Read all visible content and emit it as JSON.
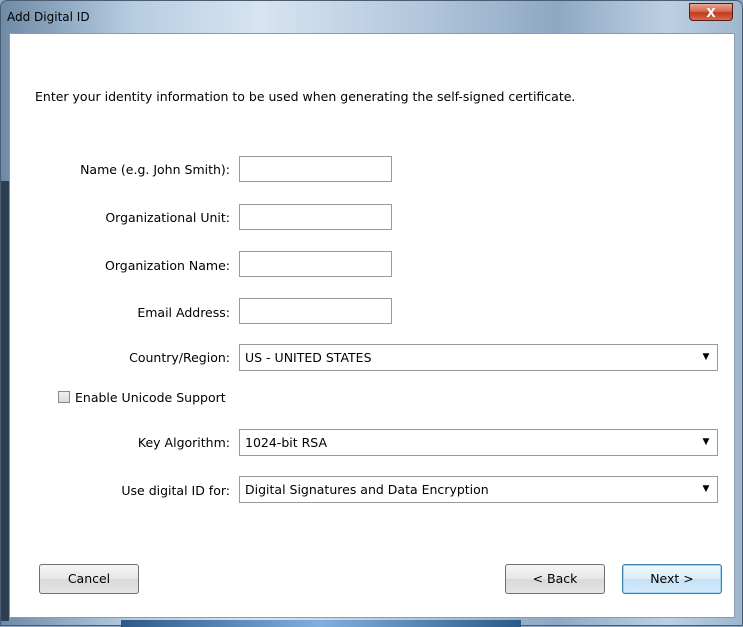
{
  "window": {
    "title": "Add Digital ID",
    "close_glyph": "X"
  },
  "intro": "Enter your identity information to be used when generating the self-signed certificate.",
  "fields": [
    {
      "label": "Name (e.g. John Smith):",
      "value": ""
    },
    {
      "label": "Organizational Unit:",
      "value": ""
    },
    {
      "label": "Organization Name:",
      "value": ""
    },
    {
      "label": "Email Address:",
      "value": ""
    }
  ],
  "country": {
    "label": "Country/Region:",
    "value": "US - UNITED STATES"
  },
  "unicode": {
    "label": "Enable Unicode Support",
    "checked": false
  },
  "key_algorithm": {
    "label": "Key Algorithm:",
    "value": "1024-bit RSA"
  },
  "use_for": {
    "label": "Use digital ID for:",
    "value": "Digital Signatures and Data Encryption"
  },
  "buttons": {
    "cancel": "Cancel",
    "back": "< Back",
    "next": "Next >"
  },
  "icons": {
    "dropdown": "chevron-down-icon",
    "close": "close-icon"
  }
}
